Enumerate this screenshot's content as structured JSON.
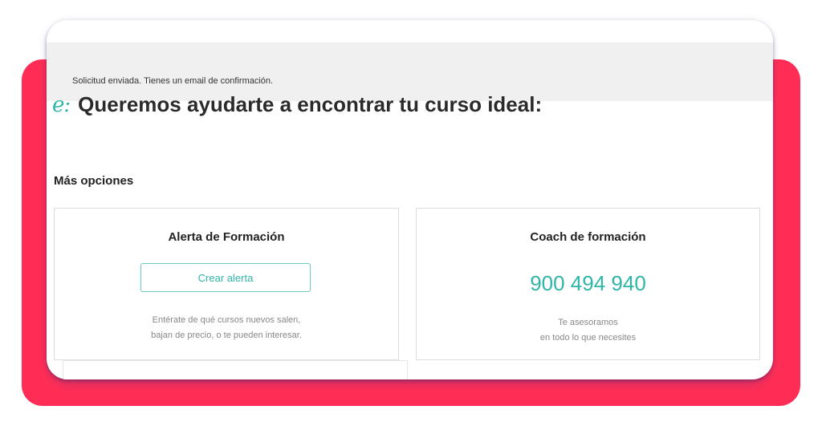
{
  "notice": {
    "text": "Solicitud enviada. Tienes un email de confirmación."
  },
  "header": {
    "brand_icon": "e:",
    "title": "Queremos ayudarte a encontrar tu curso ideal:"
  },
  "section": {
    "title": "Más opciones"
  },
  "cards": [
    {
      "title": "Alerta de Formación",
      "button_label": "Crear alerta",
      "description_lines": [
        "Entérate de qué cursos nuevos salen,",
        "bajan de precio, o te pueden interesar."
      ]
    },
    {
      "title": "Coach de formación",
      "phone": "900 494 940",
      "description_lines": [
        "Te asesoramos",
        "en todo lo que necesites"
      ]
    }
  ],
  "colors": {
    "accent": "#2fb6a6",
    "backdrop": "#ff2d55",
    "notice_bg": "#f0f0f0"
  }
}
